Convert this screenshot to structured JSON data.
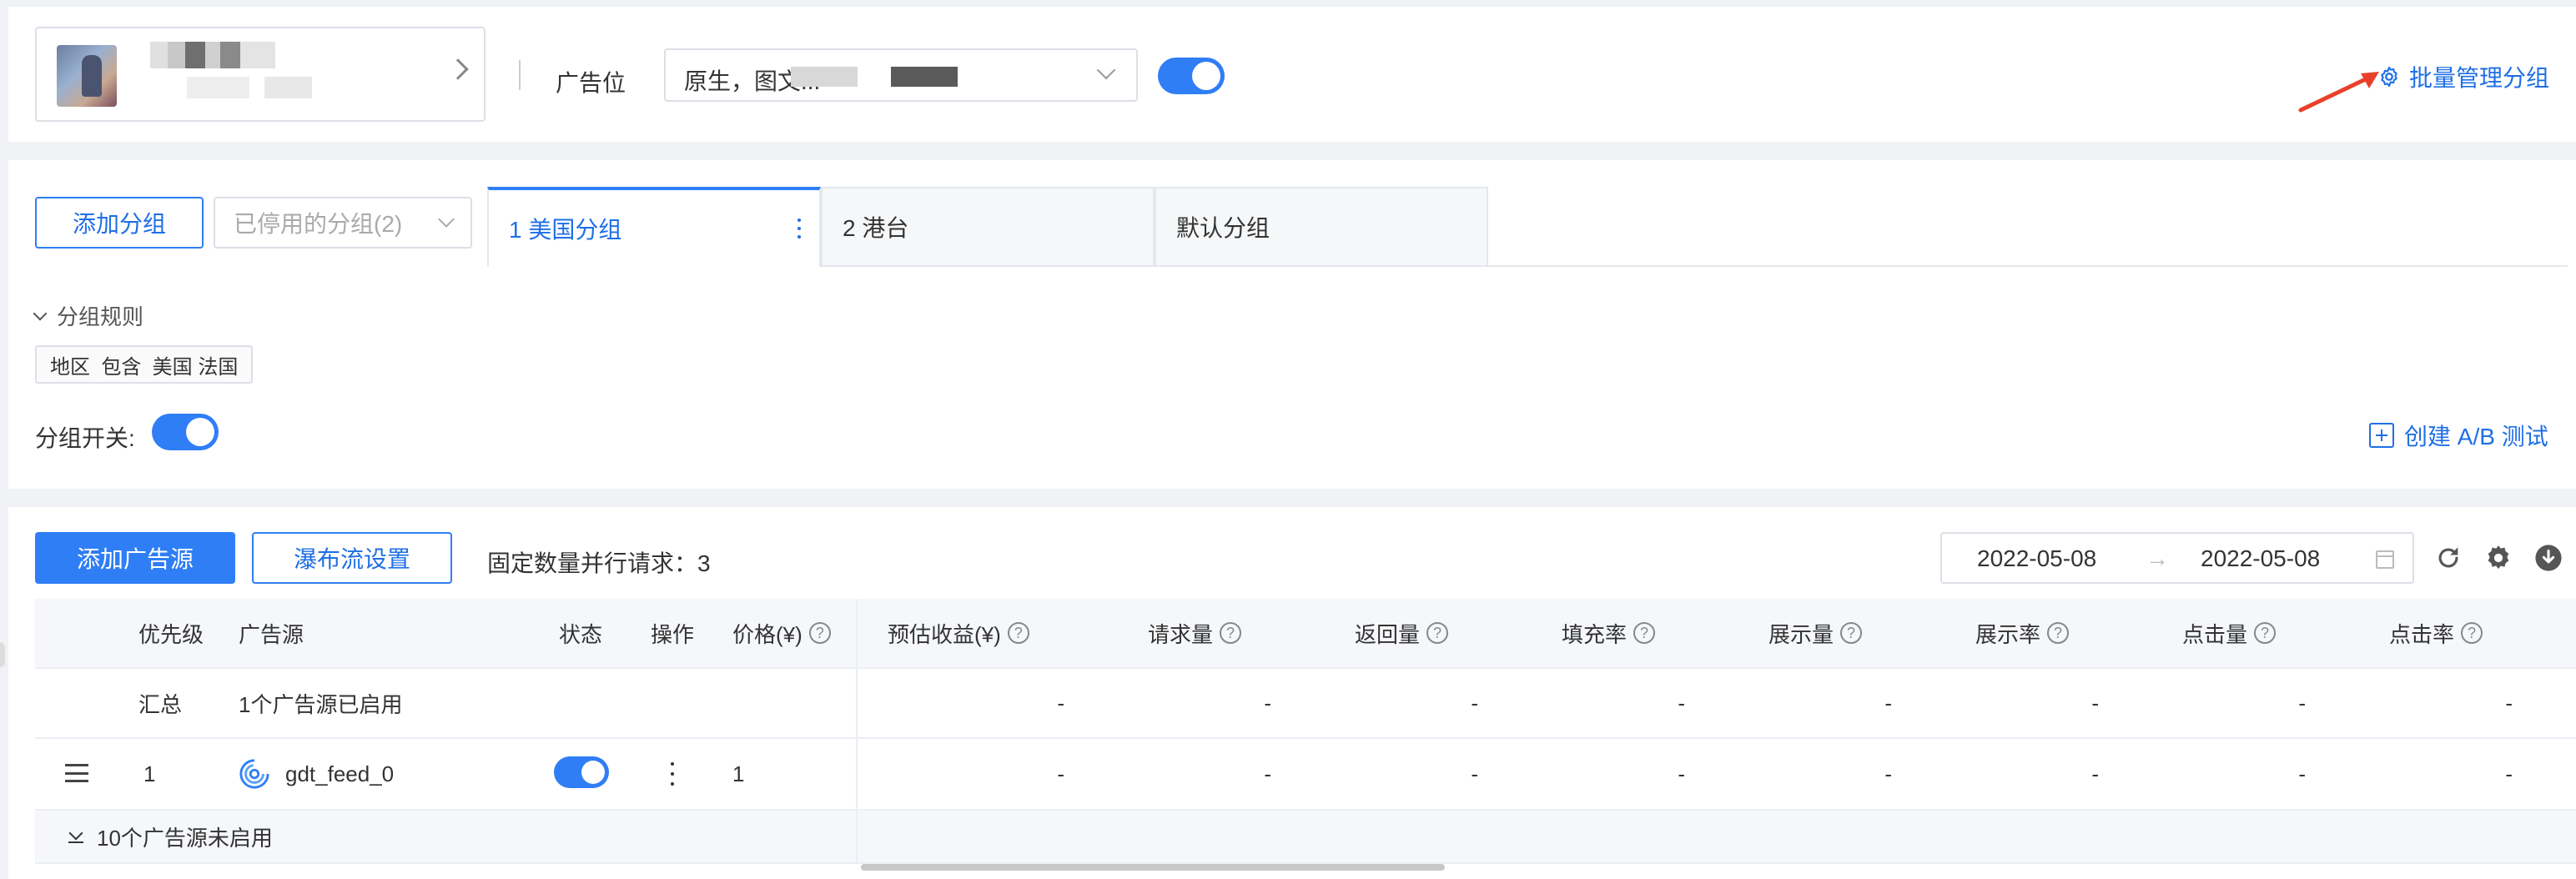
{
  "header": {
    "ad_position_label": "广告位",
    "ad_position_value": "原生，图文...",
    "batch_manage_label": "批量管理分组",
    "toggle_on": true
  },
  "groups": {
    "add_group_label": "添加分组",
    "disabled_groups_label": "已停用的分组(2)",
    "tabs": [
      {
        "label": "1 美国分组",
        "active": true
      },
      {
        "label": "2 港台",
        "active": false
      },
      {
        "label": "默认分组",
        "active": false
      }
    ],
    "rules_label": "分组规则",
    "rule_tag": "地区  包含  美国 法国",
    "group_switch_label": "分组开关:",
    "create_ab_label": "创建 A/B 测试"
  },
  "toolbar": {
    "add_source_label": "添加广告源",
    "waterfall_label": "瀑布流设置",
    "parallel_label": "固定数量并行请求：3",
    "date_start": "2022-05-08",
    "date_arrow": "→",
    "date_end": "2022-05-08"
  },
  "table": {
    "columns": [
      "优先级",
      "广告源",
      "状态",
      "操作",
      "价格(¥)",
      "预估收益(¥)",
      "请求量",
      "返回量",
      "填充率",
      "展示量",
      "展示率",
      "点击量",
      "点击率"
    ],
    "summary": {
      "label": "汇总",
      "desc": "1个广告源已启用",
      "metrics": [
        "-",
        "-",
        "-",
        "-",
        "-",
        "-",
        "-",
        "-"
      ]
    },
    "rows": [
      {
        "priority": "1",
        "source": "gdt_feed_0",
        "status_on": true,
        "price": "1",
        "metrics": [
          "-",
          "-",
          "-",
          "-",
          "-",
          "-",
          "-",
          "-"
        ]
      }
    ],
    "disabled_footer": "10个广告源未启用"
  },
  "colors": {
    "primary": "#2f7ef5",
    "link": "#1f6fe6",
    "annotation_arrow": "#e8402a"
  }
}
